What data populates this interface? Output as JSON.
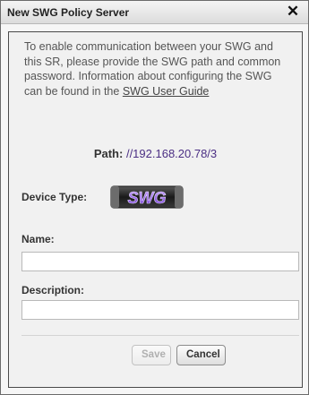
{
  "dialog": {
    "title": "New SWG Policy Server",
    "close_label": "✕"
  },
  "intro": {
    "text": "To enable communication between your SWG and this SR, please provide the SWG path and common password. Information about configuring the SWG can be found in the",
    "link_label": "SWG User Guide"
  },
  "path": {
    "label": "Path:",
    "value": "//192.168.20.78/3"
  },
  "device_type": {
    "label": "Device Type:",
    "logo_text": "SWG",
    "icon": "swg-device-icon",
    "logo_color": "#7b3fd6"
  },
  "form": {
    "name_label": "Name:",
    "name_value": "",
    "description_label": "Description:",
    "description_value": ""
  },
  "buttons": {
    "save_label": "Save",
    "cancel_label": "Cancel"
  }
}
